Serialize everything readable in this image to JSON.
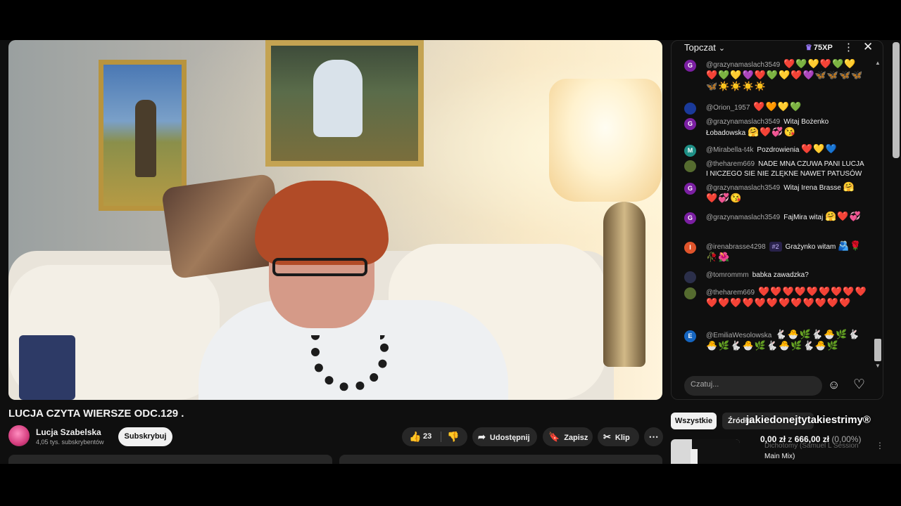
{
  "video": {
    "title": "LUCJA CZYTA WIERSZE ODC.129 ."
  },
  "channel": {
    "name": "Lucja Szabelska",
    "subscribers": "4,05 tys. subskrybentów",
    "subscribe_label": "Subskrybuj"
  },
  "actions": {
    "likes": "23",
    "share": "Udostępnij",
    "save": "Zapisz",
    "clip": "Klip"
  },
  "chat": {
    "title": "Topczat",
    "xp": "75XP",
    "input_placeholder": "Czatuj...",
    "messages": [
      {
        "author": "@grazynamaslach3549",
        "text": "",
        "emoji": "❤️💚💛❤️💚💛❤️💚💛💜❤️💚💛❤️💜🦋🦋🦋🦋🦋☀️☀️☀️☀️",
        "avatar": "G",
        "avatar_color": "#7b1fa2"
      },
      {
        "author": "@Orion_1957",
        "text": "",
        "emoji": "❤️🧡💛💚",
        "avatar": "",
        "avatar_color": "#1a3a9a"
      },
      {
        "author": "@grazynamaslach3549",
        "text": "Witaj Bożenko Łobadowska",
        "emoji": "🤗❤️💞😘",
        "avatar": "G",
        "avatar_color": "#7b1fa2"
      },
      {
        "author": "@Mirabella-t4k",
        "text": "Pozdrowienia",
        "emoji": "❤️💛💙",
        "avatar": "M",
        "avatar_color": "#1e8f86"
      },
      {
        "author": "@theharem669",
        "text": "NADE MNA CZUWA PANI LUCJA I NICZEGO SIE NIE ZLĘKNE NAWET PATUSÓW",
        "emoji": "",
        "avatar": "",
        "avatar_color": "#556b2f"
      },
      {
        "author": "@grazynamaslach3549",
        "text": "Witaj Irena Brasse",
        "emoji": "🤗❤️💞😘",
        "avatar": "G",
        "avatar_color": "#7b1fa2"
      },
      {
        "author": "@grazynamaslach3549",
        "text": "FajMira witaj",
        "emoji": "🤗❤️💞",
        "avatar": "G",
        "avatar_color": "#7b1fa2"
      },
      {
        "author": "@irenabrasse4298",
        "badge": "#2",
        "text": "Grażynko witam",
        "emoji": "🫂🌹🥀🌺",
        "avatar": "I",
        "avatar_color": "#e0542b"
      },
      {
        "author": "@tomrommm",
        "text": "babka zawadzka?",
        "emoji": "",
        "avatar": "",
        "avatar_color": "#2b2f4a"
      },
      {
        "author": "@theharem669",
        "text": "",
        "emoji": "❤️❤️❤️❤️❤️❤️❤️❤️❤️❤️❤️❤️❤️❤️❤️❤️❤️❤️❤️❤️❤️",
        "avatar": "",
        "avatar_color": "#556b2f"
      },
      {
        "author": "@EmiliaWesolowska",
        "text": "",
        "emoji": "🐇🐣🌿🐇🐣🌿🐇🐣🌿🐇🐣🌿🐇🐣🌿🐇🐣🌿",
        "avatar": "E",
        "avatar_color": "#1565c0"
      }
    ]
  },
  "sidebar": {
    "chip_all": "Wszystkie",
    "chip_src": "Źródło:",
    "overlay_title": "jakiedonejtytakiestrimy®",
    "money_current": "0,00 zł",
    "money_sep": "z",
    "money_goal": "666,00 zł",
    "money_pct": "(0,00%)",
    "rec_title_dim": "Dichotomy (Samuel L Session",
    "rec_title_rest": "Main Mix)"
  }
}
